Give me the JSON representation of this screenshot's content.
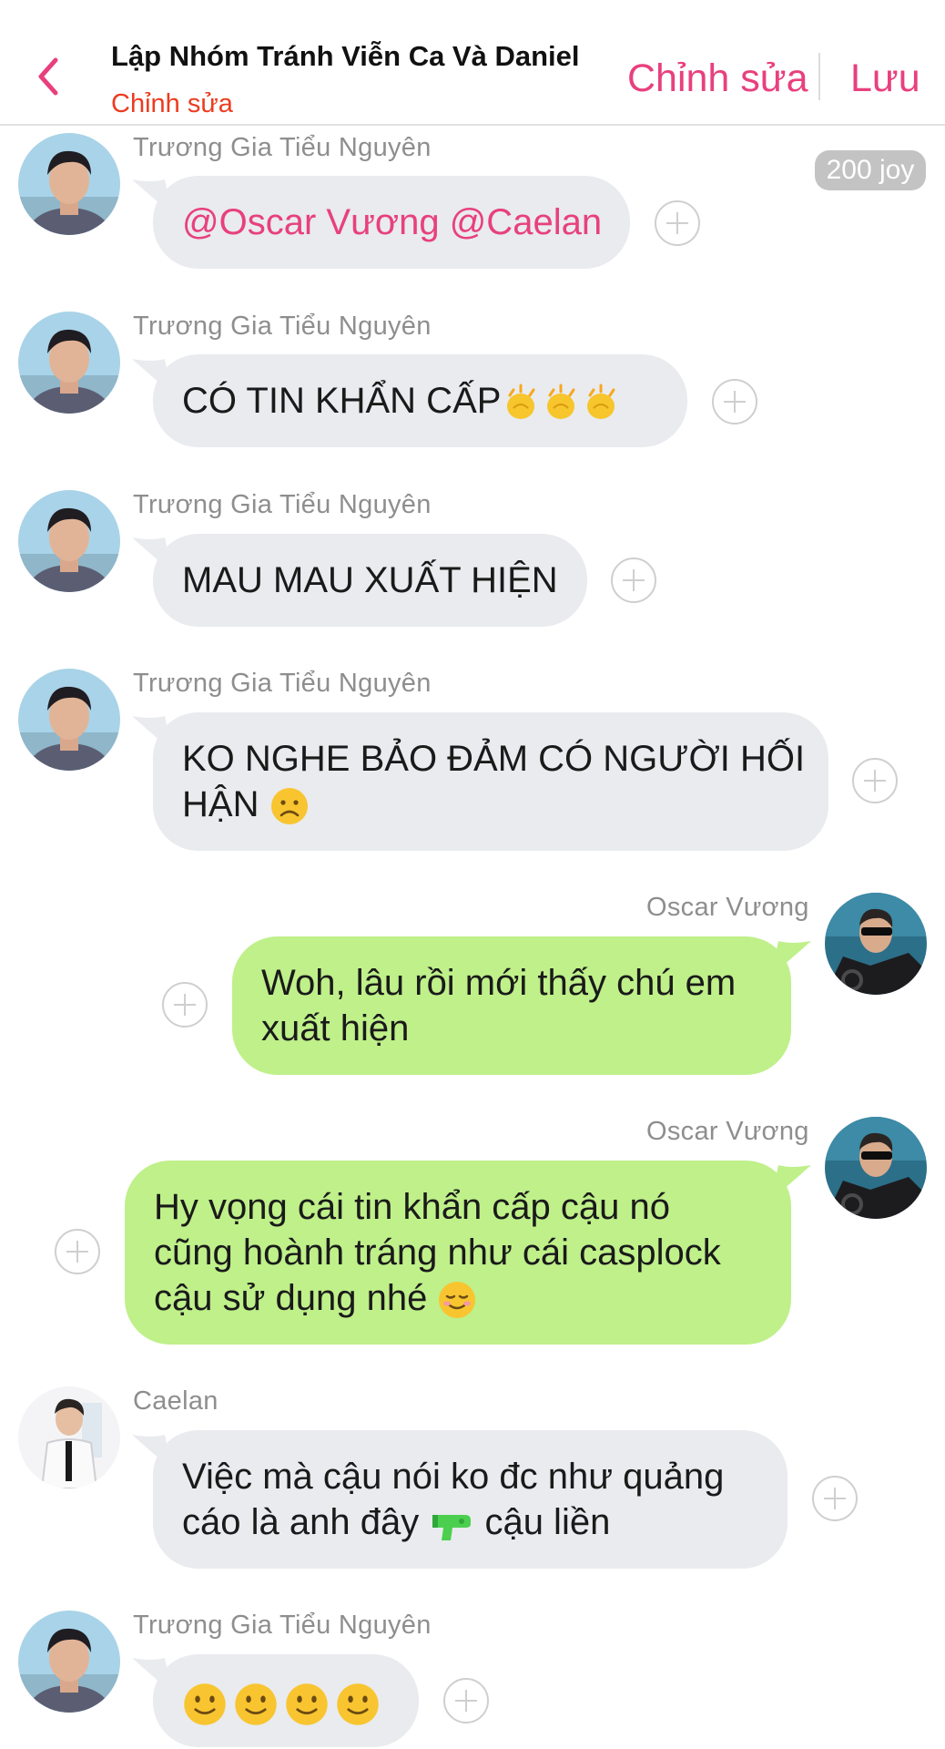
{
  "header": {
    "title": "Lập Nhóm Tránh Viễn Ca Và Daniel",
    "subtitle": "Chỉnh sửa",
    "edit_label": "Chỉnh sửa",
    "save_label": "Lưu",
    "accent_color": "#e8407e",
    "subtitle_color": "#ec3b1f"
  },
  "badge": {
    "label": "200 joy"
  },
  "messages": [
    {
      "sender": "Trương Gia Tiểu Nguyên",
      "side": "left",
      "text_a": "@Oscar Vương",
      "text_b": "@Caelan",
      "style": "mention"
    },
    {
      "sender": "Trương Gia Tiểu Nguyên",
      "side": "left",
      "text": "CÓ TIN KHẨN CẤP",
      "emoji": [
        "clapping-hands",
        "clapping-hands",
        "clapping-hands"
      ]
    },
    {
      "sender": "Trương Gia Tiểu Nguyên",
      "side": "left",
      "text": "MAU MAU XUẤT HIỆN"
    },
    {
      "sender": "Trương Gia Tiểu Nguyên",
      "side": "left",
      "line1": "KO NGHE BẢO ĐẢM CÓ NGƯỜI HỐI",
      "line2": "HẬN",
      "emoji": [
        "frowning-face"
      ]
    },
    {
      "sender": "Oscar Vương",
      "side": "right",
      "line1": "Woh, lâu rồi mới thấy chú em",
      "line2": "xuất hiện"
    },
    {
      "sender": "Oscar Vương",
      "side": "right",
      "line1": "Hy vọng cái tin khẩn cấp cậu nó",
      "line2": "cũng hoành tráng như cái casplock",
      "line3": "cậu sử dụng nhé",
      "emoji": [
        "relieved-face"
      ]
    },
    {
      "sender": "Caelan",
      "side": "left",
      "line1": "Việc mà cậu nói ko đc như quảng",
      "line2a": "cáo là anh đây",
      "line2b": "cậu liền",
      "emoji": [
        "water-pistol"
      ]
    },
    {
      "sender": "Trương Gia Tiểu Nguyên",
      "side": "left",
      "emoji": [
        "slightly-smiling-face",
        "slightly-smiling-face",
        "slightly-smiling-face",
        "slightly-smiling-face"
      ]
    }
  ],
  "colors": {
    "bubble_left": "#e9ebee",
    "bubble_right": "#bff08a",
    "sender_text": "#8e8e8e",
    "badge_bg": "#c3c3c3"
  }
}
